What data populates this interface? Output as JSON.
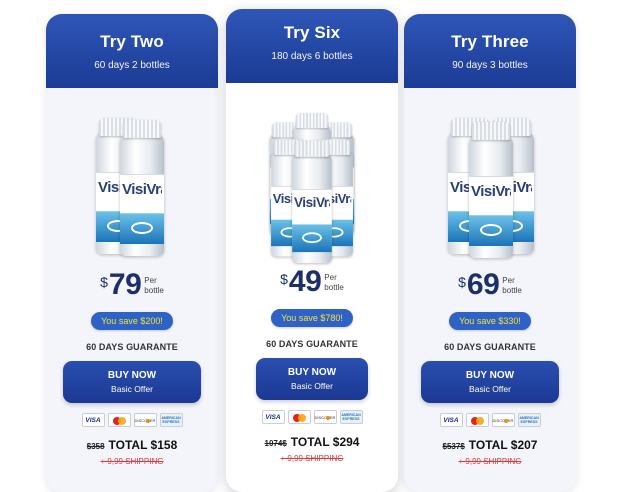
{
  "plans": [
    {
      "title": "Try Two",
      "subtitle": "60 days 2 bottles",
      "bottle_brand": "VisiVra",
      "currency": "$",
      "price": "79",
      "per_line1": "Per",
      "per_line2": "bottle",
      "save": "You save $200!",
      "guarantee": "60 DAYS GUARANTE",
      "buy_label": "BUY NOW",
      "buy_sub": "Basic Offer",
      "old_price": "$358",
      "total": "TOTAL $158",
      "shipping": "+ 9,99 SHIPPING"
    },
    {
      "title": "Try Six",
      "subtitle": "180 days 6 bottles",
      "bottle_brand": "VisiVra",
      "currency": "$",
      "price": "49",
      "per_line1": "Per",
      "per_line2": "bottle",
      "save": "You save $780!",
      "guarantee": "60 DAYS GUARANTE",
      "buy_label": "BUY NOW",
      "buy_sub": "Basic Offer",
      "old_price": "1074$",
      "total": "TOTAL $294",
      "shipping": "+ 9,99 SHIPPING"
    },
    {
      "title": "Try Three",
      "subtitle": "90 days 3 bottles",
      "bottle_brand": "VisiVra",
      "currency": "$",
      "price": "69",
      "per_line1": "Per",
      "per_line2": "bottle",
      "save": "You save $330!",
      "guarantee": "60 DAYS GUARANTE",
      "buy_label": "BUY NOW",
      "buy_sub": "Basic Offer",
      "old_price": "$537$",
      "total": "TOTAL $207",
      "shipping": "+ 9,99 SHIPPING"
    }
  ],
  "payment_methods": [
    "VISA",
    "mastercard",
    "DISCOVER",
    "AMERICAN EXPRESS"
  ],
  "colors": {
    "header_blue": "#1f419c",
    "button_blue": "#1b3893",
    "save_text_yellow": "#f5e430",
    "shipping_red": "#e23a3a"
  }
}
